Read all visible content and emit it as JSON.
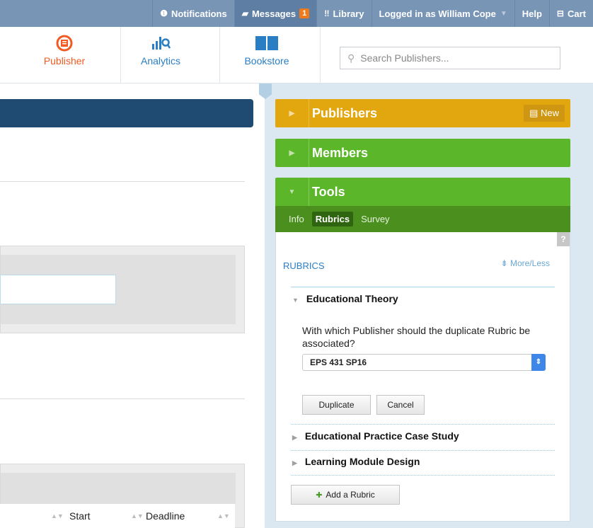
{
  "topbar": {
    "notifications": "Notifications",
    "messages": "Messages",
    "messages_count": "1",
    "library": "Library",
    "logged_in": "Logged in as William Cope",
    "help": "Help",
    "cart": "Cart"
  },
  "nav": {
    "publisher": "Publisher",
    "analytics": "Analytics",
    "bookstore": "Bookstore",
    "search_placeholder": "Search Publishers..."
  },
  "left": {
    "columns": [
      "Start",
      "Deadline"
    ]
  },
  "sidebar": {
    "publishers": "Publishers",
    "new_label": "New",
    "members": "Members",
    "tools": "Tools",
    "tabs": [
      "Info",
      "Rubrics",
      "Survey"
    ],
    "active_tab": "Rubrics",
    "help": "?",
    "rubrics_title": "RUBRICS",
    "more_less": "More/Less",
    "rubrics": [
      {
        "name": "Educational Theory",
        "expanded": true
      },
      {
        "name": "Educational Practice Case Study",
        "expanded": false
      },
      {
        "name": "Learning Module Design",
        "expanded": false
      }
    ],
    "question": "With which Publisher should the duplicate Rubric be associated?",
    "selected_publisher": "EPS 431 SP16",
    "duplicate": "Duplicate",
    "cancel": "Cancel",
    "add_rubric": "Add a Rubric"
  },
  "colors": {
    "publishers_header": "#e2a60f",
    "members_header": "#5cb62a",
    "tools_tabs": "#4b8f1f",
    "accent_orange": "#f15a22",
    "link_blue": "#2a7ec4"
  }
}
